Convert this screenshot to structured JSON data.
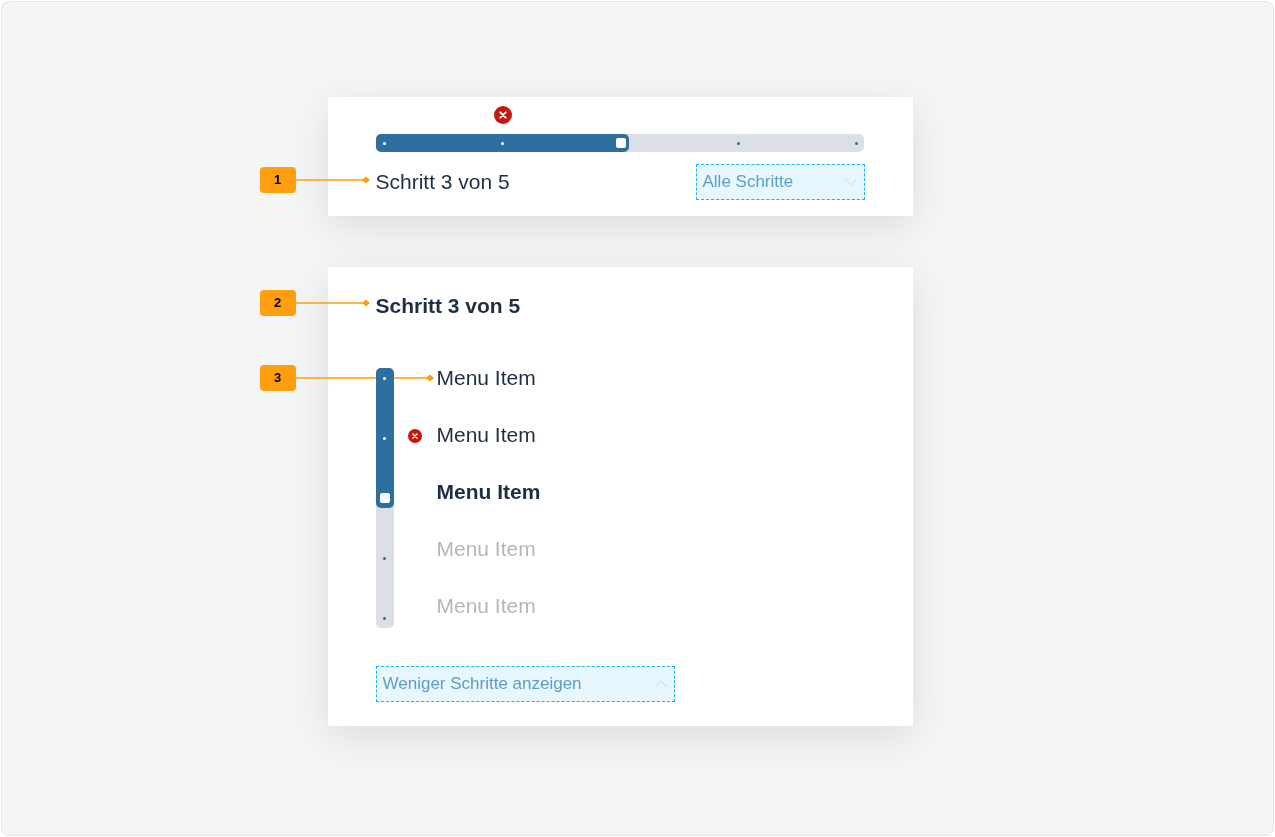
{
  "annotations": [
    {
      "label": "1"
    },
    {
      "label": "2"
    },
    {
      "label": "3"
    }
  ],
  "horizontal": {
    "steps": [
      {
        "kind": "done"
      },
      {
        "kind": "error"
      },
      {
        "kind": "current"
      },
      {
        "kind": "upcoming"
      },
      {
        "kind": "upcoming"
      }
    ],
    "caption": "Schritt 3 von 5",
    "toggle": {
      "label": "Alle Schritte"
    }
  },
  "vertical": {
    "title": "Schritt 3 von 5",
    "items": [
      {
        "label": "Menu Item",
        "kind": "done"
      },
      {
        "label": "Menu Item",
        "kind": "error"
      },
      {
        "label": "Menu Item",
        "kind": "current"
      },
      {
        "label": "Menu Item",
        "kind": "upcoming"
      },
      {
        "label": "Menu Item",
        "kind": "upcoming"
      }
    ],
    "toggle": {
      "label": "Weniger Schritte anzeigen"
    }
  }
}
